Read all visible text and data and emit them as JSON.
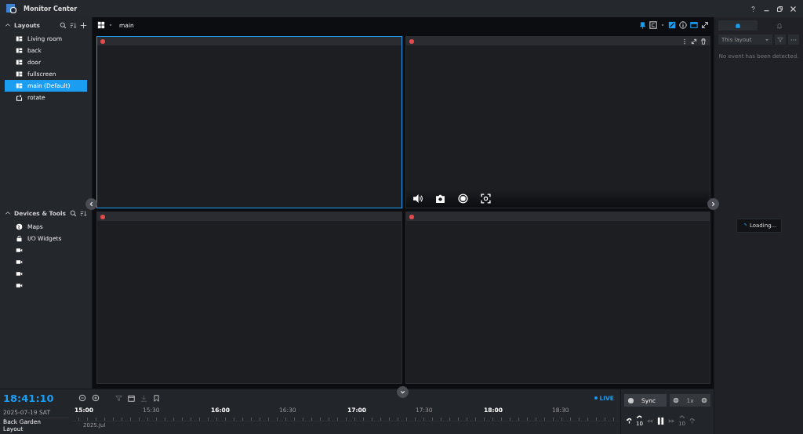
{
  "window": {
    "title": "Monitor Center"
  },
  "sidebar": {
    "layouts": {
      "title": "Layouts",
      "expanded": true,
      "items": [
        {
          "label": "Living room",
          "kind": "layout",
          "selected": false
        },
        {
          "label": "back",
          "kind": "layout",
          "selected": false
        },
        {
          "label": "door",
          "kind": "layout",
          "selected": false
        },
        {
          "label": "fullscreen",
          "kind": "layout",
          "selected": false
        },
        {
          "label": "main (Default)",
          "kind": "layout",
          "selected": true
        },
        {
          "label": "rotate",
          "kind": "rotate",
          "selected": false
        }
      ]
    },
    "devices": {
      "title": "Devices & Tools",
      "expanded": true,
      "items": [
        {
          "label": "Maps",
          "kind": "map"
        },
        {
          "label": "I/O Widgets",
          "kind": "io"
        },
        {
          "kind": "camera"
        },
        {
          "kind": "camera"
        },
        {
          "kind": "camera"
        },
        {
          "kind": "camera"
        }
      ]
    }
  },
  "toolbar": {
    "layout_name": "main"
  },
  "tiles": [
    {
      "selected": true,
      "hovered": false
    },
    {
      "selected": false,
      "hovered": true
    },
    {
      "selected": false,
      "hovered": false
    },
    {
      "selected": false,
      "hovered": false
    }
  ],
  "events": {
    "tabs": [
      {
        "kind": "event",
        "selected": true
      },
      {
        "kind": "bell",
        "selected": false
      }
    ],
    "filter": "This layout",
    "message": "No event has been detected.",
    "loading": "Loading..."
  },
  "timeline": {
    "time": "18:41:10",
    "date": "2025-07-19 SAT",
    "camera": "Back Garden",
    "row_label": "Layout",
    "month": "2025.Jul",
    "live": "LIVE",
    "ticks": [
      {
        "label": "15:00",
        "major": true
      },
      {
        "label": "15:30",
        "major": false
      },
      {
        "label": "16:00",
        "major": true
      },
      {
        "label": "16:30",
        "major": false
      },
      {
        "label": "17:00",
        "major": true
      },
      {
        "label": "17:30",
        "major": false
      },
      {
        "label": "18:00",
        "major": true
      },
      {
        "label": "18:30",
        "major": false
      }
    ],
    "sync": "Sync",
    "speed": {
      "label": "1x",
      "disabled": true
    },
    "controls": [
      {
        "kind": "jump-back",
        "disabled": false
      },
      {
        "kind": "skip-back",
        "label": "10",
        "disabled": false
      },
      {
        "kind": "rewind",
        "disabled": true
      },
      {
        "kind": "pause",
        "disabled": false
      },
      {
        "kind": "forward",
        "disabled": true
      },
      {
        "kind": "skip-forward",
        "label": "10",
        "disabled": true
      },
      {
        "kind": "jump-forward",
        "disabled": true
      }
    ]
  }
}
